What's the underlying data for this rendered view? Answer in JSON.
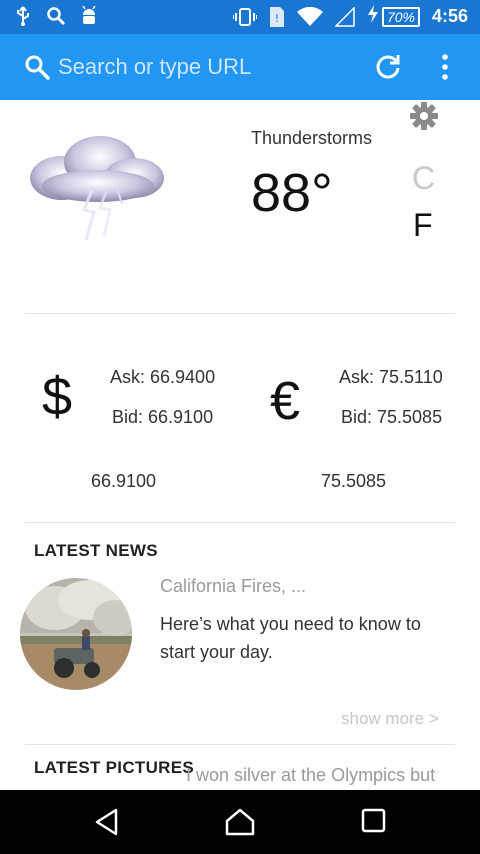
{
  "status_bar": {
    "battery": "70%",
    "time": "4:56",
    "left_icons": [
      "usb-icon",
      "search-icon",
      "android-icon"
    ],
    "right_icons": [
      "vibrate-icon",
      "sim-icon",
      "wifi-icon",
      "signal-icon",
      "charging-icon"
    ]
  },
  "browser": {
    "url_placeholder": "Search or type URL",
    "color": "#2196f3",
    "status_color": "#1976d2"
  },
  "weather": {
    "condition": "Thunderstorms",
    "temperature": "88°",
    "unit_c": "C",
    "unit_f": "F",
    "selected_unit": "F",
    "icon": "thunderstorm-cloud-icon"
  },
  "currency": [
    {
      "symbol": "$",
      "ask": "Ask: 66.9400",
      "bid": "Bid: 66.9100",
      "value": "66.9100"
    },
    {
      "symbol": "€",
      "ask": "Ask: 75.5110",
      "bid": "Bid: 75.5085",
      "value": "75.5085"
    }
  ],
  "news": {
    "section_title": "LATEST NEWS",
    "headline": "California Fires, ...",
    "summary": "Here’s what you need to know to start your day.",
    "show_more": "show more >"
  },
  "pictures": {
    "section_title": "LATEST PICTURES",
    "caption": "I won silver at the Olympics but"
  }
}
